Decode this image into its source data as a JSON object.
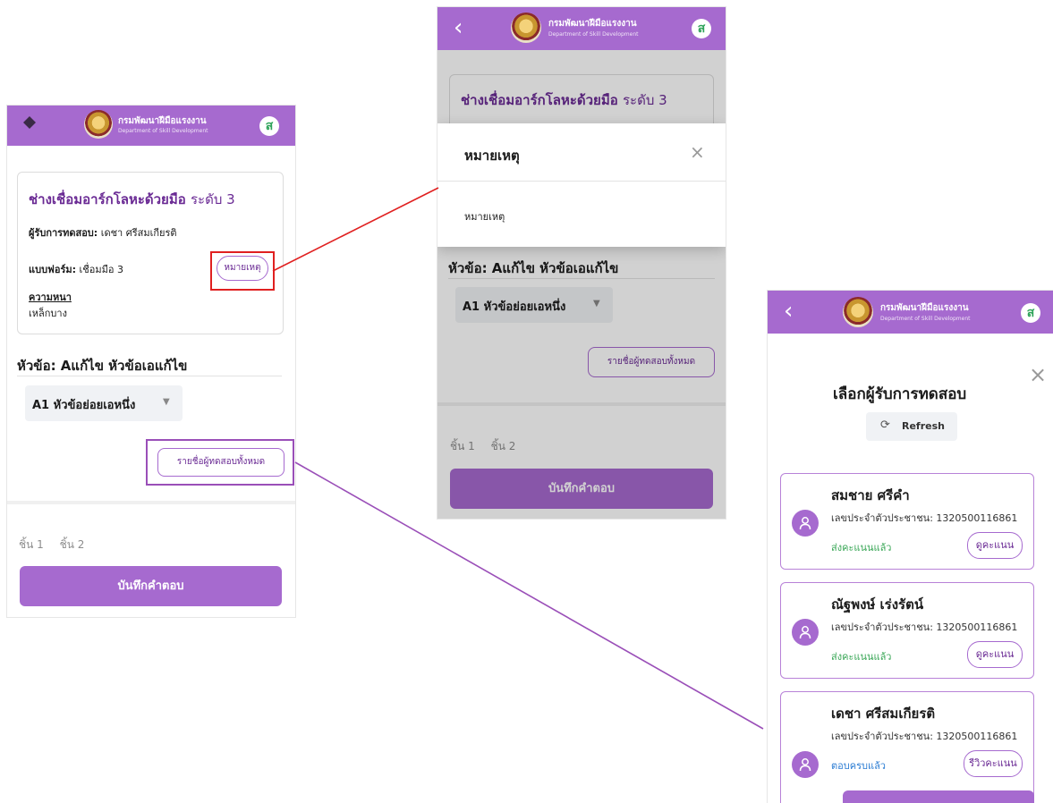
{
  "header": {
    "org_th": "กรมพัฒนาฝีมือแรงงาน",
    "org_en": "Department of Skill Development",
    "avatar_letter": "ส",
    "back_glyph": "‹"
  },
  "form": {
    "title_bold": "ช่างเชื่อมอาร์กโลหะด้วยมือ",
    "title_level": "ระดับ 3",
    "examinee_label": "ผู้รับการทดสอบ:",
    "examinee_value": "เดชา ศรีสมเกียรติ",
    "form_label": "แบบฟอร์ม:",
    "form_value": "เชื่อมมือ 3",
    "note_button": "หมายเหตุ",
    "thickness_label": "ความหนา",
    "thickness_value": "เหล็กบาง",
    "topic": "หัวข้อ: Aแก้ไข หัวข้อเอแก้ไข",
    "subtopic": "A1 หัวข้อย่อยเอหนึ่ง",
    "all_examinees_button": "รายชื่อผู้ทดสอบทั้งหมด",
    "tab1": "ชิ้น 1",
    "tab2": "ชิ้น 2",
    "save_button": "บันทึกคำตอบ"
  },
  "note_modal": {
    "title": "หมายเหตุ",
    "close_glyph": "×",
    "body": "หมายเหตุ"
  },
  "select_panel": {
    "title": "เลือกผู้รับการทดสอบ",
    "close_glyph": "×",
    "refresh_label": "Refresh",
    "people": [
      {
        "name": "สมชาย ศรีคำ",
        "id_line": "เลขประจำตัวประชาชน: 1320500116861",
        "status": "ส่งคะแนนแล้ว",
        "status_color": "#3aa757",
        "button": "ดูคะแนน"
      },
      {
        "name": "ณัฐพงษ์ เร่งรัตน์",
        "id_line": "เลขประจำตัวประชาชน: 1320500116861",
        "status": "ส่งคะแนนแล้ว",
        "status_color": "#3aa757",
        "button": "ดูคะแนน"
      },
      {
        "name": "เดชา ศรีสมเกียรติ",
        "id_line": "เลขประจำตัวประชาชน: 1320500116861",
        "status": "ตอบครบแล้ว",
        "status_color": "#2b7cd3",
        "button": "รีวิวคะแนน"
      }
    ]
  },
  "colors": {
    "brand": "#a66acf",
    "accent_text": "#6a2a94",
    "callout_red": "#e02020",
    "callout_purple": "#9a4fb8"
  }
}
